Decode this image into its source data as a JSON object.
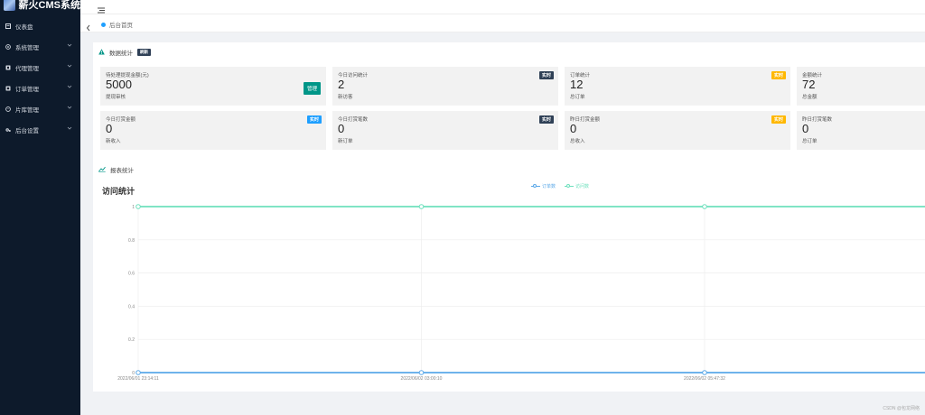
{
  "app": {
    "title": "薪火CMS系统"
  },
  "sidebar": {
    "items": [
      {
        "label": "仪表盘",
        "icon": "dashboard-icon",
        "has_children": false
      },
      {
        "label": "系统管理",
        "icon": "settings-circle-icon",
        "has_children": true
      },
      {
        "label": "代理管理",
        "icon": "agent-icon",
        "has_children": true
      },
      {
        "label": "订单管理",
        "icon": "order-icon",
        "has_children": true
      },
      {
        "label": "片库管理",
        "icon": "library-icon",
        "has_children": true
      },
      {
        "label": "后台设置",
        "icon": "gear-icon",
        "has_children": true
      }
    ]
  },
  "breadcrumb": {
    "label": "后台首页"
  },
  "stats": {
    "title": "数据统计",
    "badge": "刷新",
    "cards": [
      {
        "title": "待处理提现金额(元)",
        "value": "5000",
        "sub": "提现审核",
        "button": "管理"
      },
      {
        "title": "今日访问统计",
        "value": "2",
        "sub": "新访客",
        "tag": "实时",
        "tag_color": "#2f4056"
      },
      {
        "title": "订单统计",
        "value": "12",
        "sub": "总订单",
        "tag": "实时",
        "tag_color": "#ffb800"
      },
      {
        "title": "金额统计",
        "value": "72",
        "sub": "总金额"
      },
      {
        "title": "今日打赏金额",
        "value": "0",
        "sub": "新收入",
        "tag": "实时",
        "tag_color": "#1e9fff"
      },
      {
        "title": "今日打赏笔数",
        "value": "0",
        "sub": "新订单",
        "tag": "实时",
        "tag_color": "#2f4056"
      },
      {
        "title": "昨日打赏金额",
        "value": "0",
        "sub": "总收入",
        "tag": "实时",
        "tag_color": "#ffb800"
      },
      {
        "title": "昨日打赏笔数",
        "value": "0",
        "sub": "总订单"
      }
    ]
  },
  "report": {
    "title": "报表统计",
    "chart_title": "访问统计"
  },
  "chart_data": {
    "type": "line",
    "title": "访问统计",
    "x": [
      "2022/06/01 23:14:11",
      "2022/06/02 03:00:10",
      "2022/06/02 05:47:32",
      ""
    ],
    "ylim": [
      0,
      1
    ],
    "y_ticks": [
      "0",
      "0.2",
      "0.4",
      "0.6",
      "0.8",
      "1"
    ],
    "series": [
      {
        "name": "订单数",
        "values": [
          0,
          0,
          0,
          0
        ],
        "color": "#5aa8e8"
      },
      {
        "name": "访问数",
        "values": [
          1,
          1,
          1,
          1
        ],
        "color": "#6ee0bd"
      }
    ],
    "grid": true,
    "legend": "top-center"
  },
  "footer": {
    "text": "CSDN @包龙网络"
  }
}
